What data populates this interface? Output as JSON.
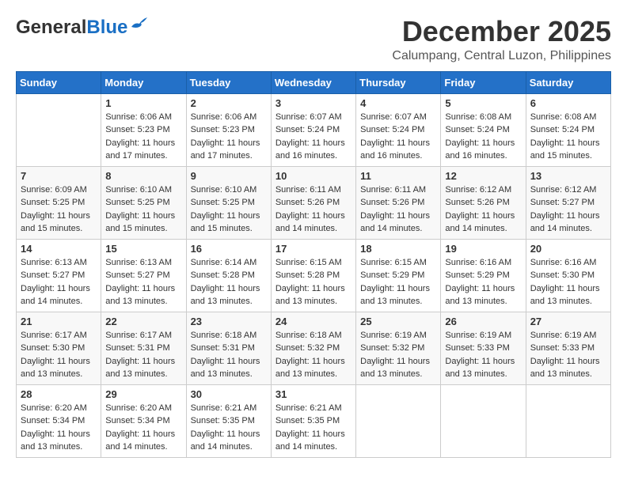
{
  "header": {
    "logo": {
      "general": "General",
      "blue": "Blue"
    },
    "month": "December 2025",
    "location": "Calumpang, Central Luzon, Philippines"
  },
  "calendar": {
    "headers": [
      "Sunday",
      "Monday",
      "Tuesday",
      "Wednesday",
      "Thursday",
      "Friday",
      "Saturday"
    ],
    "weeks": [
      [
        {
          "day": "",
          "info": ""
        },
        {
          "day": "1",
          "info": "Sunrise: 6:06 AM\nSunset: 5:23 PM\nDaylight: 11 hours\nand 17 minutes."
        },
        {
          "day": "2",
          "info": "Sunrise: 6:06 AM\nSunset: 5:23 PM\nDaylight: 11 hours\nand 17 minutes."
        },
        {
          "day": "3",
          "info": "Sunrise: 6:07 AM\nSunset: 5:24 PM\nDaylight: 11 hours\nand 16 minutes."
        },
        {
          "day": "4",
          "info": "Sunrise: 6:07 AM\nSunset: 5:24 PM\nDaylight: 11 hours\nand 16 minutes."
        },
        {
          "day": "5",
          "info": "Sunrise: 6:08 AM\nSunset: 5:24 PM\nDaylight: 11 hours\nand 16 minutes."
        },
        {
          "day": "6",
          "info": "Sunrise: 6:08 AM\nSunset: 5:24 PM\nDaylight: 11 hours\nand 15 minutes."
        }
      ],
      [
        {
          "day": "7",
          "info": "Sunrise: 6:09 AM\nSunset: 5:25 PM\nDaylight: 11 hours\nand 15 minutes."
        },
        {
          "day": "8",
          "info": "Sunrise: 6:10 AM\nSunset: 5:25 PM\nDaylight: 11 hours\nand 15 minutes."
        },
        {
          "day": "9",
          "info": "Sunrise: 6:10 AM\nSunset: 5:25 PM\nDaylight: 11 hours\nand 15 minutes."
        },
        {
          "day": "10",
          "info": "Sunrise: 6:11 AM\nSunset: 5:26 PM\nDaylight: 11 hours\nand 14 minutes."
        },
        {
          "day": "11",
          "info": "Sunrise: 6:11 AM\nSunset: 5:26 PM\nDaylight: 11 hours\nand 14 minutes."
        },
        {
          "day": "12",
          "info": "Sunrise: 6:12 AM\nSunset: 5:26 PM\nDaylight: 11 hours\nand 14 minutes."
        },
        {
          "day": "13",
          "info": "Sunrise: 6:12 AM\nSunset: 5:27 PM\nDaylight: 11 hours\nand 14 minutes."
        }
      ],
      [
        {
          "day": "14",
          "info": "Sunrise: 6:13 AM\nSunset: 5:27 PM\nDaylight: 11 hours\nand 14 minutes."
        },
        {
          "day": "15",
          "info": "Sunrise: 6:13 AM\nSunset: 5:27 PM\nDaylight: 11 hours\nand 13 minutes."
        },
        {
          "day": "16",
          "info": "Sunrise: 6:14 AM\nSunset: 5:28 PM\nDaylight: 11 hours\nand 13 minutes."
        },
        {
          "day": "17",
          "info": "Sunrise: 6:15 AM\nSunset: 5:28 PM\nDaylight: 11 hours\nand 13 minutes."
        },
        {
          "day": "18",
          "info": "Sunrise: 6:15 AM\nSunset: 5:29 PM\nDaylight: 11 hours\nand 13 minutes."
        },
        {
          "day": "19",
          "info": "Sunrise: 6:16 AM\nSunset: 5:29 PM\nDaylight: 11 hours\nand 13 minutes."
        },
        {
          "day": "20",
          "info": "Sunrise: 6:16 AM\nSunset: 5:30 PM\nDaylight: 11 hours\nand 13 minutes."
        }
      ],
      [
        {
          "day": "21",
          "info": "Sunrise: 6:17 AM\nSunset: 5:30 PM\nDaylight: 11 hours\nand 13 minutes."
        },
        {
          "day": "22",
          "info": "Sunrise: 6:17 AM\nSunset: 5:31 PM\nDaylight: 11 hours\nand 13 minutes."
        },
        {
          "day": "23",
          "info": "Sunrise: 6:18 AM\nSunset: 5:31 PM\nDaylight: 11 hours\nand 13 minutes."
        },
        {
          "day": "24",
          "info": "Sunrise: 6:18 AM\nSunset: 5:32 PM\nDaylight: 11 hours\nand 13 minutes."
        },
        {
          "day": "25",
          "info": "Sunrise: 6:19 AM\nSunset: 5:32 PM\nDaylight: 11 hours\nand 13 minutes."
        },
        {
          "day": "26",
          "info": "Sunrise: 6:19 AM\nSunset: 5:33 PM\nDaylight: 11 hours\nand 13 minutes."
        },
        {
          "day": "27",
          "info": "Sunrise: 6:19 AM\nSunset: 5:33 PM\nDaylight: 11 hours\nand 13 minutes."
        }
      ],
      [
        {
          "day": "28",
          "info": "Sunrise: 6:20 AM\nSunset: 5:34 PM\nDaylight: 11 hours\nand 13 minutes."
        },
        {
          "day": "29",
          "info": "Sunrise: 6:20 AM\nSunset: 5:34 PM\nDaylight: 11 hours\nand 14 minutes."
        },
        {
          "day": "30",
          "info": "Sunrise: 6:21 AM\nSunset: 5:35 PM\nDaylight: 11 hours\nand 14 minutes."
        },
        {
          "day": "31",
          "info": "Sunrise: 6:21 AM\nSunset: 5:35 PM\nDaylight: 11 hours\nand 14 minutes."
        },
        {
          "day": "",
          "info": ""
        },
        {
          "day": "",
          "info": ""
        },
        {
          "day": "",
          "info": ""
        }
      ]
    ]
  }
}
